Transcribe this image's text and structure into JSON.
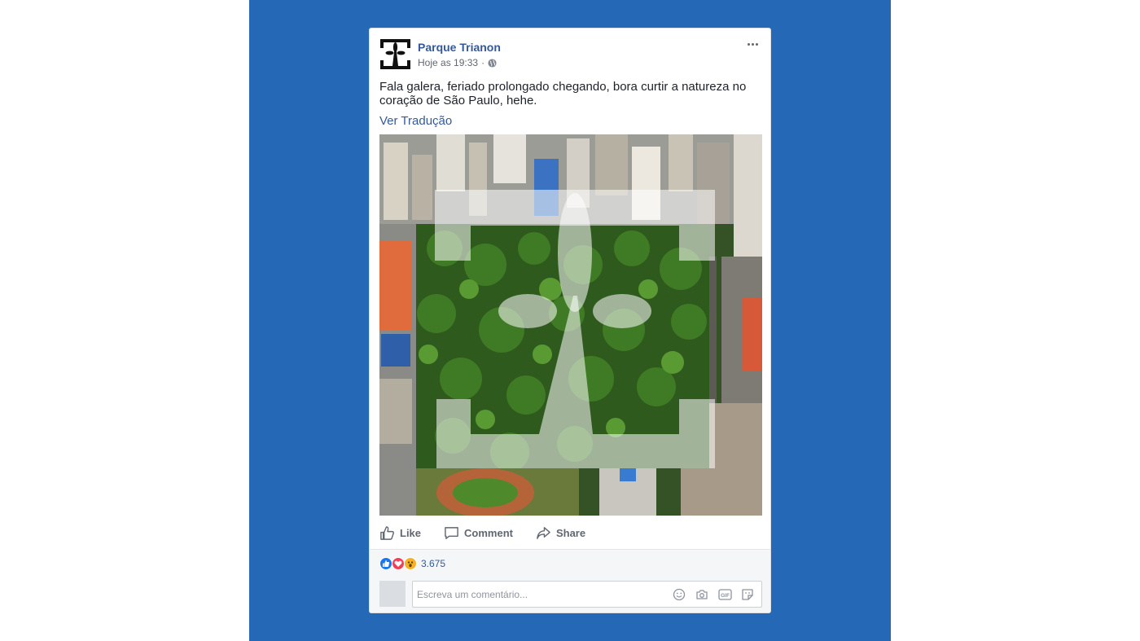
{
  "post": {
    "page_name": "Parque Trianon",
    "timestamp": "Hoje as 19:33",
    "separator": "·",
    "text": "Fala galera, feriado prolongado chegando, bora curtir a natureza no coração de São Paulo, hehe.",
    "translate_link": "Ver Tradução"
  },
  "actions": {
    "like_label": "Like",
    "comment_label": "Comment",
    "share_label": "Share"
  },
  "reactions": {
    "count": "3.675",
    "icons": [
      "like-reaction-icon",
      "love-reaction-icon",
      "wow-reaction-icon"
    ]
  },
  "comment": {
    "placeholder": "Escreva um comentário...",
    "tools": [
      "emoji-icon",
      "camera-icon",
      "gif-icon",
      "sticker-icon"
    ]
  },
  "colors": {
    "background_panel": "#2468b6",
    "link": "#365899",
    "like_blue": "#1877f2",
    "love_red": "#f33e58",
    "wow_yellow": "#f7b125"
  }
}
